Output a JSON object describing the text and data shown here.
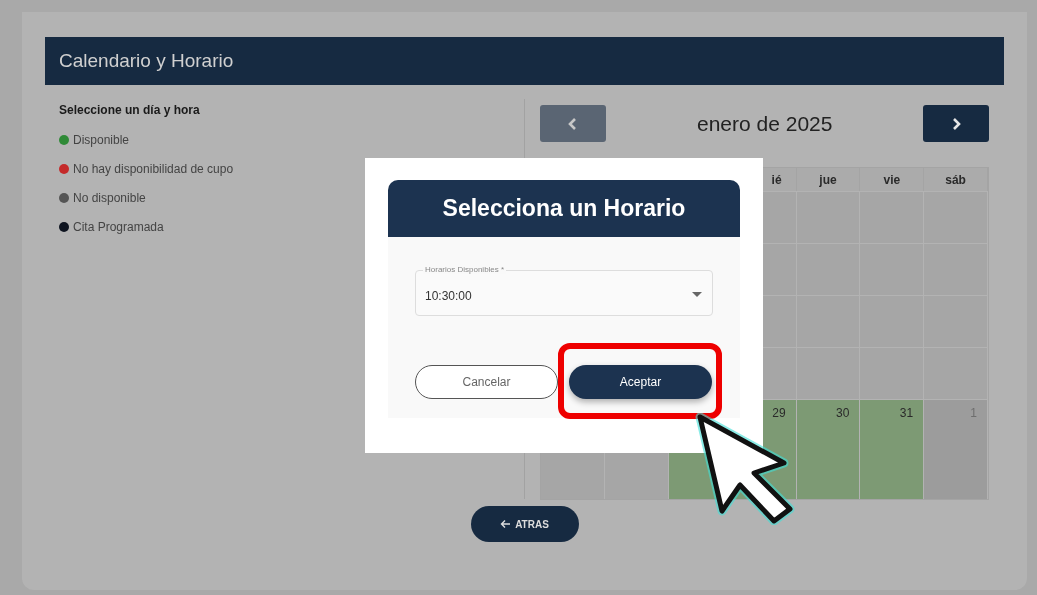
{
  "header": {
    "title": "Calendario y Horario"
  },
  "legend": {
    "title": "Seleccione un día y hora",
    "items": [
      {
        "label": "Disponible",
        "color": "#2f8a37"
      },
      {
        "label": "No hay disponibilidad de cupo",
        "color": "#c42a2a"
      },
      {
        "label": "No disponible",
        "color": "#555555"
      },
      {
        "label": "Cita Programada",
        "color": "#0e1420"
      }
    ]
  },
  "calendar": {
    "month": "enero de 2025",
    "prev": {
      "disabled": true
    },
    "next": {
      "disabled": false
    },
    "weekdays": [
      "ié",
      "jue",
      "vie",
      "sáb"
    ],
    "weeks": [
      [
        {
          "available": false
        },
        {
          "available": false
        },
        {
          "available": false
        },
        {
          "available": false
        }
      ],
      [
        {
          "available": false
        },
        {
          "available": false
        },
        {
          "available": false
        },
        {
          "available": false
        }
      ],
      [
        {
          "available": false
        },
        {
          "available": false
        },
        {
          "available": false
        },
        {
          "available": false
        }
      ],
      [
        {
          "available": false
        },
        {
          "available": false
        },
        {
          "available": false
        },
        {
          "available": false
        }
      ],
      [
        {
          "available": false
        },
        {
          "available": false
        },
        {
          "available": true
        },
        {
          "day": "29",
          "available": true
        },
        {
          "day": "30",
          "available": true
        },
        {
          "day": "31",
          "available": true
        },
        {
          "day": "1",
          "outside_month": true
        }
      ]
    ]
  },
  "dialog": {
    "title": "Selecciona un Horario",
    "select": {
      "label": "Horarios Disponibles *",
      "value": "10:30:00"
    },
    "buttons": [
      {
        "label": "Cancelar",
        "kind": "secondary",
        "highlighted": false
      },
      {
        "label": "Aceptar",
        "kind": "primary",
        "highlighted": true
      }
    ]
  },
  "back_button": {
    "label": "ATRAS"
  }
}
